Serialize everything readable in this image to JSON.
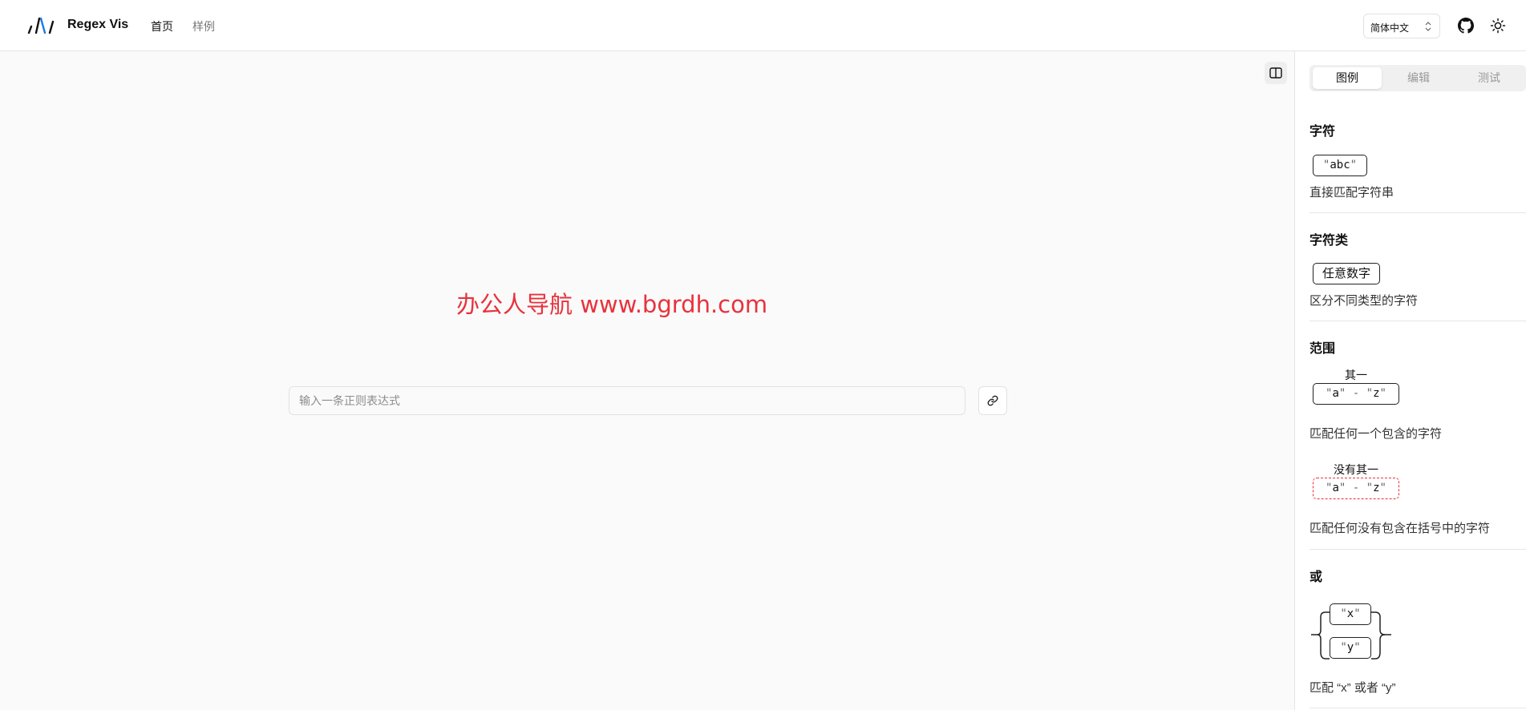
{
  "header": {
    "brand": "Regex Vis",
    "nav": {
      "home": "首页",
      "examples": "样例"
    },
    "language": "简体中文",
    "icons": {
      "logo": "regex-vis-logo-icon",
      "updown": "chevron-up-down-icon",
      "github": "github-icon",
      "theme": "sun-icon"
    }
  },
  "main": {
    "watermark": "办公人导航 www.bgrdh.com",
    "input_placeholder": "输入一条正则表达式",
    "icons": {
      "panel_toggle": "sidebar-toggle-icon",
      "link": "link-icon"
    }
  },
  "sidebar": {
    "tabs": [
      "图例",
      "编辑",
      "测试"
    ],
    "sections": {
      "chars": {
        "title": "字符",
        "node_text": "abc",
        "desc": "直接匹配字符串"
      },
      "charclass": {
        "title": "字符类",
        "node_text": "任意数字",
        "desc": "区分不同类型的字符"
      },
      "range": {
        "title": "范围",
        "caption": "其一",
        "from": "a",
        "to": "z",
        "desc": "匹配任何一个包含的字符",
        "neg_caption": "没有其一",
        "neg_desc": "匹配任何没有包含在括号中的字符"
      },
      "or": {
        "title": "或",
        "opt1": "x",
        "opt2": "y",
        "desc": "匹配 “x” 或者 “y”"
      }
    }
  },
  "colors": {
    "accent_red": "#e8323c",
    "text": "#111111",
    "muted": "#999999",
    "border": "#e2e2e2"
  }
}
